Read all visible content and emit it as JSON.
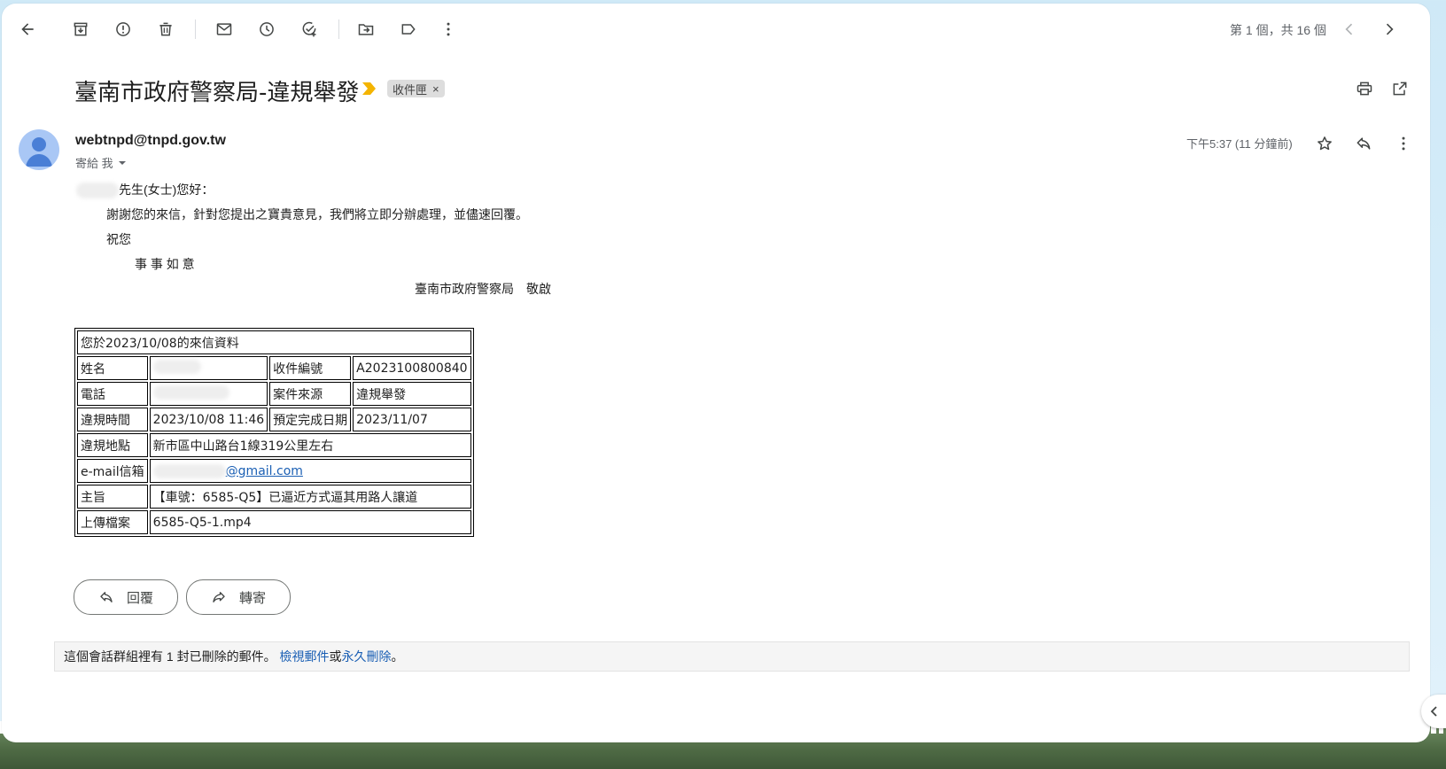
{
  "toolbar": {
    "back": "back-icon",
    "archive": "archive-icon",
    "report_spam": "report-spam-icon",
    "delete": "trash-icon",
    "mark_unread": "mail-icon",
    "snooze": "clock-icon",
    "add_task": "add-task-icon",
    "move_to": "move-to-folder-icon",
    "labels": "label-icon",
    "more": "more-vert-icon",
    "pager": "第 1 個，共 16 個"
  },
  "subject": {
    "title": "臺南市政府警察局-違規舉發",
    "label": "收件匣",
    "label_remove": "×"
  },
  "message": {
    "sender": "webtnpd@tnpd.gov.tw",
    "recipient": "寄給 我",
    "time": "下午5:37 (11 分鐘前)",
    "greeting": "先生(女士)您好：",
    "line1": "謝謝您的來信，針對您提出之寶貴意見，我們將立即分辦處理，並儘速回覆。",
    "line2": "祝您",
    "line3": "事 事 如 意",
    "signature": "臺南市政府警察局　敬啟"
  },
  "info_table": {
    "header": "您於2023/10/08的來信資料",
    "name_label": "姓名",
    "case_no_label": "收件編號",
    "case_no": "A2023100800840",
    "phone_label": "電話",
    "source_label": "案件來源",
    "source": "違規舉發",
    "time_label": "違規時間",
    "time": "2023/10/08 11:46",
    "due_label": "預定完成日期",
    "due": "2023/11/07",
    "location_label": "違規地點",
    "location": "新市區中山路台1線319公里左右",
    "email_label": "e-mail信箱",
    "email_visible": "@gmail.com",
    "subject_label": "主旨",
    "subject": "【車號：6585-Q5】已逼近方式逼其用路人讓道",
    "file_label": "上傳檔案",
    "file": "6585-Q5-1.mp4"
  },
  "actions": {
    "reply": "回覆",
    "forward": "轉寄"
  },
  "deleted_notice": {
    "text": "這個會話群組裡有 1 封已刪除的郵件。",
    "view_link": "檢視郵件",
    "or": "或",
    "delete_link": "永久刪除",
    "end": "。"
  },
  "colors": {
    "accent_link": "#1a5fb4",
    "importance_marker": "#f4b400",
    "avatar_bg": "#a9c7f5"
  }
}
